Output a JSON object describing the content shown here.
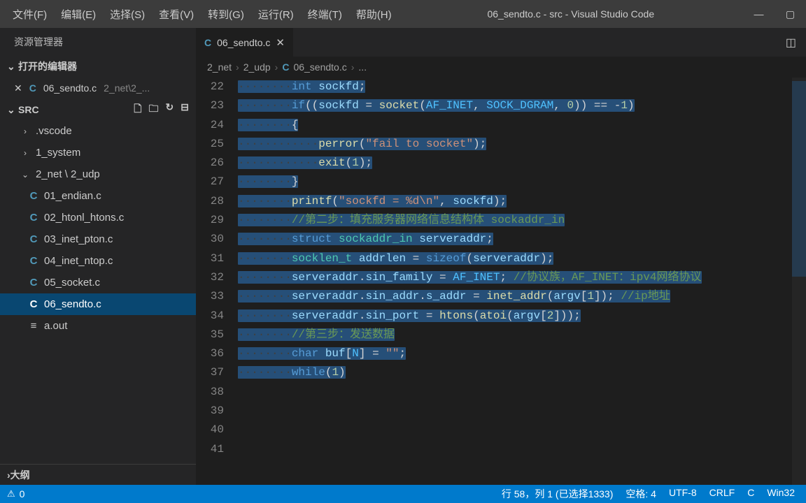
{
  "titlebar": {
    "title": "06_sendto.c - src - Visual Studio Code"
  },
  "menu": [
    "文件(F)",
    "编辑(E)",
    "选择(S)",
    "查看(V)",
    "转到(G)",
    "运行(R)",
    "终端(T)",
    "帮助(H)"
  ],
  "sidebar": {
    "title": "资源管理器",
    "open_editors_header": "打开的编辑器",
    "open_file": {
      "name": "06_sendto.c",
      "path": "2_net\\2_..."
    },
    "src_header": "SRC",
    "tree": {
      "vscode": ".vscode",
      "sys": "1_system",
      "net": "2_net \\ 2_udp",
      "f1": "01_endian.c",
      "f2": "02_htonl_htons.c",
      "f3": "03_inet_pton.c",
      "f4": "04_inet_ntop.c",
      "f5": "05_socket.c",
      "f6": "06_sendto.c",
      "aout": "a.out"
    },
    "outline": "大纲"
  },
  "tab": {
    "name": "06_sendto.c"
  },
  "breadcrumb": {
    "p1": "2_net",
    "p2": "2_udp",
    "p3": "06_sendto.c",
    "extra": "..."
  },
  "code": {
    "line_start": 22,
    "lines": [
      {
        "n": 22,
        "tokens": [
          [
            "ws",
            "····"
          ],
          [
            "ws",
            "····"
          ],
          [
            "kw",
            "int"
          ],
          [
            "op",
            " "
          ],
          [
            "var",
            "sockfd"
          ],
          [
            "op",
            ";"
          ]
        ]
      },
      {
        "n": 23,
        "tokens": [
          [
            "ws",
            "····"
          ],
          [
            "ws",
            "····"
          ],
          [
            "kw",
            "if"
          ],
          [
            "op",
            "(("
          ],
          [
            "var",
            "sockfd"
          ],
          [
            "op",
            " = "
          ],
          [
            "fn",
            "socket"
          ],
          [
            "op",
            "("
          ],
          [
            "const",
            "AF_INET"
          ],
          [
            "op",
            ", "
          ],
          [
            "const",
            "SOCK_DGRAM"
          ],
          [
            "op",
            ", "
          ],
          [
            "num",
            "0"
          ],
          [
            "op",
            ")) == -"
          ],
          [
            "num",
            "1"
          ],
          [
            "op",
            ")"
          ]
        ]
      },
      {
        "n": 24,
        "tokens": [
          [
            "ws",
            "····"
          ],
          [
            "ws",
            "····"
          ],
          [
            "op",
            "{"
          ]
        ]
      },
      {
        "n": 25,
        "tokens": [
          [
            "ws",
            "····"
          ],
          [
            "ws",
            "····"
          ],
          [
            "ws",
            "····"
          ],
          [
            "fn",
            "perror"
          ],
          [
            "op",
            "("
          ],
          [
            "str",
            "\"fail to socket\""
          ],
          [
            "op",
            ");"
          ]
        ]
      },
      {
        "n": 26,
        "tokens": [
          [
            "ws",
            "····"
          ],
          [
            "ws",
            "····"
          ],
          [
            "ws",
            "····"
          ],
          [
            "fn",
            "exit"
          ],
          [
            "op",
            "("
          ],
          [
            "num",
            "1"
          ],
          [
            "op",
            ");"
          ]
        ]
      },
      {
        "n": 27,
        "tokens": [
          [
            "ws",
            "····"
          ],
          [
            "ws",
            "····"
          ],
          [
            "op",
            "}"
          ]
        ]
      },
      {
        "n": 28,
        "tokens": [
          [
            "ws",
            ""
          ]
        ]
      },
      {
        "n": 29,
        "tokens": [
          [
            "ws",
            "····"
          ],
          [
            "ws",
            "····"
          ],
          [
            "fn",
            "printf"
          ],
          [
            "op",
            "("
          ],
          [
            "str",
            "\"sockfd = %d\\n\""
          ],
          [
            "op",
            ", "
          ],
          [
            "var",
            "sockfd"
          ],
          [
            "op",
            ");"
          ]
        ]
      },
      {
        "n": 30,
        "tokens": [
          [
            "ws",
            ""
          ]
        ]
      },
      {
        "n": 31,
        "tokens": [
          [
            "ws",
            "····"
          ],
          [
            "ws",
            "····"
          ],
          [
            "cmt",
            "//第二步：填充服务器网络信息结构体 sockaddr_in"
          ]
        ]
      },
      {
        "n": 32,
        "tokens": [
          [
            "ws",
            "····"
          ],
          [
            "ws",
            "····"
          ],
          [
            "kw",
            "struct"
          ],
          [
            "op",
            " "
          ],
          [
            "typ",
            "sockaddr_in"
          ],
          [
            "op",
            " "
          ],
          [
            "var",
            "serveraddr"
          ],
          [
            "op",
            ";"
          ]
        ]
      },
      {
        "n": 33,
        "tokens": [
          [
            "ws",
            "····"
          ],
          [
            "ws",
            "····"
          ],
          [
            "typ",
            "socklen_t"
          ],
          [
            "op",
            " "
          ],
          [
            "var",
            "addrlen"
          ],
          [
            "op",
            " = "
          ],
          [
            "kw",
            "sizeof"
          ],
          [
            "op",
            "("
          ],
          [
            "var",
            "serveraddr"
          ],
          [
            "op",
            ");"
          ]
        ]
      },
      {
        "n": 34,
        "tokens": [
          [
            "ws",
            ""
          ]
        ]
      },
      {
        "n": 35,
        "tokens": [
          [
            "ws",
            "····"
          ],
          [
            "ws",
            "····"
          ],
          [
            "var",
            "serveraddr"
          ],
          [
            "op",
            "."
          ],
          [
            "var",
            "sin_family"
          ],
          [
            "op",
            " = "
          ],
          [
            "const",
            "AF_INET"
          ],
          [
            "op",
            "; "
          ],
          [
            "cmt",
            "//协议族，AF_INET：ipv4网络协议"
          ]
        ]
      },
      {
        "n": 36,
        "tokens": [
          [
            "ws",
            "····"
          ],
          [
            "ws",
            "····"
          ],
          [
            "var",
            "serveraddr"
          ],
          [
            "op",
            "."
          ],
          [
            "var",
            "sin_addr"
          ],
          [
            "op",
            "."
          ],
          [
            "var",
            "s_addr"
          ],
          [
            "op",
            " = "
          ],
          [
            "fn",
            "inet_addr"
          ],
          [
            "op",
            "("
          ],
          [
            "var",
            "argv"
          ],
          [
            "op",
            "["
          ],
          [
            "num",
            "1"
          ],
          [
            "op",
            "]); "
          ],
          [
            "cmt",
            "//ip地址"
          ]
        ]
      },
      {
        "n": 37,
        "tokens": [
          [
            "ws",
            "····"
          ],
          [
            "ws",
            "····"
          ],
          [
            "var",
            "serveraddr"
          ],
          [
            "op",
            "."
          ],
          [
            "var",
            "sin_port"
          ],
          [
            "op",
            " = "
          ],
          [
            "fn",
            "htons"
          ],
          [
            "op",
            "("
          ],
          [
            "fn",
            "atoi"
          ],
          [
            "op",
            "("
          ],
          [
            "var",
            "argv"
          ],
          [
            "op",
            "["
          ],
          [
            "num",
            "2"
          ],
          [
            "op",
            "]));"
          ]
        ]
      },
      {
        "n": 38,
        "tokens": [
          [
            "ws",
            ""
          ]
        ]
      },
      {
        "n": 39,
        "tokens": [
          [
            "ws",
            "····"
          ],
          [
            "ws",
            "····"
          ],
          [
            "cmt",
            "//第三步：发送数据"
          ]
        ]
      },
      {
        "n": 40,
        "tokens": [
          [
            "ws",
            "····"
          ],
          [
            "ws",
            "····"
          ],
          [
            "kw",
            "char"
          ],
          [
            "op",
            " "
          ],
          [
            "var",
            "buf"
          ],
          [
            "op",
            "["
          ],
          [
            "const",
            "N"
          ],
          [
            "op",
            "] = "
          ],
          [
            "str",
            "\"\""
          ],
          [
            "op",
            ";"
          ]
        ]
      },
      {
        "n": 41,
        "tokens": [
          [
            "ws",
            "····"
          ],
          [
            "ws",
            "····"
          ],
          [
            "kw",
            "while"
          ],
          [
            "op",
            "("
          ],
          [
            "num",
            "1"
          ],
          [
            "op",
            ")"
          ]
        ]
      }
    ]
  },
  "status": {
    "warnings": "0",
    "cursor": "行 58，列 1 (已选择1333)",
    "spaces": "空格: 4",
    "encoding": "UTF-8",
    "eol": "CRLF",
    "lang": "C",
    "os": "Win32"
  }
}
